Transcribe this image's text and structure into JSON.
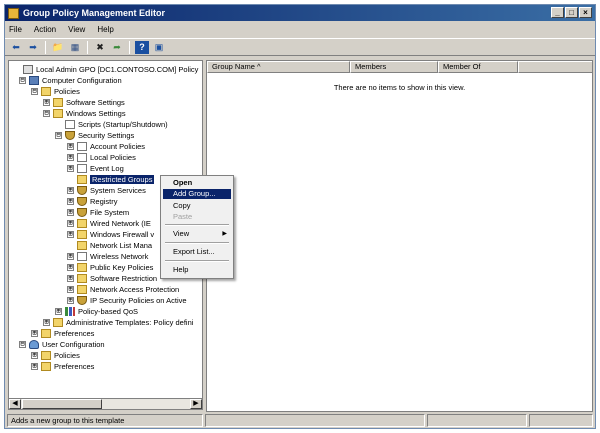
{
  "window": {
    "title": "Group Policy Management Editor",
    "buttons": {
      "minimize": "_",
      "maximize": "□",
      "close": "×"
    }
  },
  "menu": [
    "File",
    "Action",
    "View",
    "Help"
  ],
  "toolbar": {
    "icons": [
      "back-arrow-icon",
      "forward-arrow-icon",
      "folder-up-icon",
      "show-hide-tree-icon",
      "delete-icon",
      "export-list-icon",
      "help-icon",
      "properties-icon"
    ],
    "glyphs": [
      "⬅",
      "➡",
      "📁",
      "▦",
      "✖",
      "➦",
      "?",
      "▣"
    ]
  },
  "tree": {
    "items": [
      {
        "label": "Local Admin GPO [DC1.CONTOSO.COM] Policy",
        "expander": "",
        "icon": "gpo"
      },
      {
        "label": "Computer Configuration",
        "expander": "⊟",
        "icon": "computer"
      },
      {
        "label": "Policies",
        "expander": "⊟",
        "icon": "folder"
      },
      {
        "label": "Software Settings",
        "expander": "⊞",
        "icon": "folder"
      },
      {
        "label": "Windows Settings",
        "expander": "⊟",
        "icon": "folder"
      },
      {
        "label": "Scripts (Startup/Shutdown)",
        "expander": "",
        "icon": "doc"
      },
      {
        "label": "Security Settings",
        "expander": "⊟",
        "icon": "shield"
      },
      {
        "label": "Account Policies",
        "expander": "⊞",
        "icon": "doc"
      },
      {
        "label": "Local Policies",
        "expander": "⊞",
        "icon": "doc"
      },
      {
        "label": "Event Log",
        "expander": "⊞",
        "icon": "doc"
      },
      {
        "label": "Restricted Groups",
        "expander": "",
        "icon": "folder",
        "selected": true
      },
      {
        "label": "System Services",
        "expander": "⊞",
        "icon": "shield"
      },
      {
        "label": "Registry",
        "expander": "⊞",
        "icon": "shield"
      },
      {
        "label": "File System",
        "expander": "⊞",
        "icon": "shield"
      },
      {
        "label": "Wired Network (IE",
        "expander": "⊞",
        "icon": "folder"
      },
      {
        "label": "Windows Firewall v",
        "expander": "⊞",
        "icon": "folder"
      },
      {
        "label": "Network List Mana",
        "expander": "",
        "icon": "folder"
      },
      {
        "label": "Wireless Network",
        "expander": "⊞",
        "icon": "doc"
      },
      {
        "label": "Public Key Policies",
        "expander": "⊞",
        "icon": "folder"
      },
      {
        "label": "Software Restriction",
        "expander": "⊞",
        "icon": "folder"
      },
      {
        "label": "Network Access Protection",
        "expander": "⊞",
        "icon": "folder"
      },
      {
        "label": "IP Security Policies on Active",
        "expander": "⊞",
        "icon": "shield"
      },
      {
        "label": "Policy-based QoS",
        "expander": "⊞",
        "icon": "chart"
      },
      {
        "label": "Administrative Templates: Policy defini",
        "expander": "⊞",
        "icon": "folder"
      },
      {
        "label": "Preferences",
        "expander": "⊞",
        "icon": "folder"
      },
      {
        "label": "User Configuration",
        "expander": "⊟",
        "icon": "user"
      },
      {
        "label": "Policies",
        "expander": "⊞",
        "icon": "folder"
      },
      {
        "label": "Preferences",
        "expander": "⊞",
        "icon": "folder"
      }
    ]
  },
  "list": {
    "columns": [
      "Group Name  ^",
      "Members",
      "Member Of"
    ],
    "empty_message": "There are no items to show in this view."
  },
  "context_menu": {
    "items": [
      {
        "label": "Open",
        "state": "bold"
      },
      {
        "label": "Add Group...",
        "state": "highlighted"
      },
      {
        "label": "Copy",
        "state": "normal"
      },
      {
        "label": "Paste",
        "state": "disabled"
      },
      {
        "label": "View",
        "state": "normal",
        "submenu": "▶"
      },
      {
        "label": "Export List...",
        "state": "normal"
      },
      {
        "label": "Help",
        "state": "normal"
      }
    ]
  },
  "status": {
    "text": "Adds a new group to this template"
  },
  "scrollbar": {
    "left": "◀",
    "right": "▶"
  }
}
